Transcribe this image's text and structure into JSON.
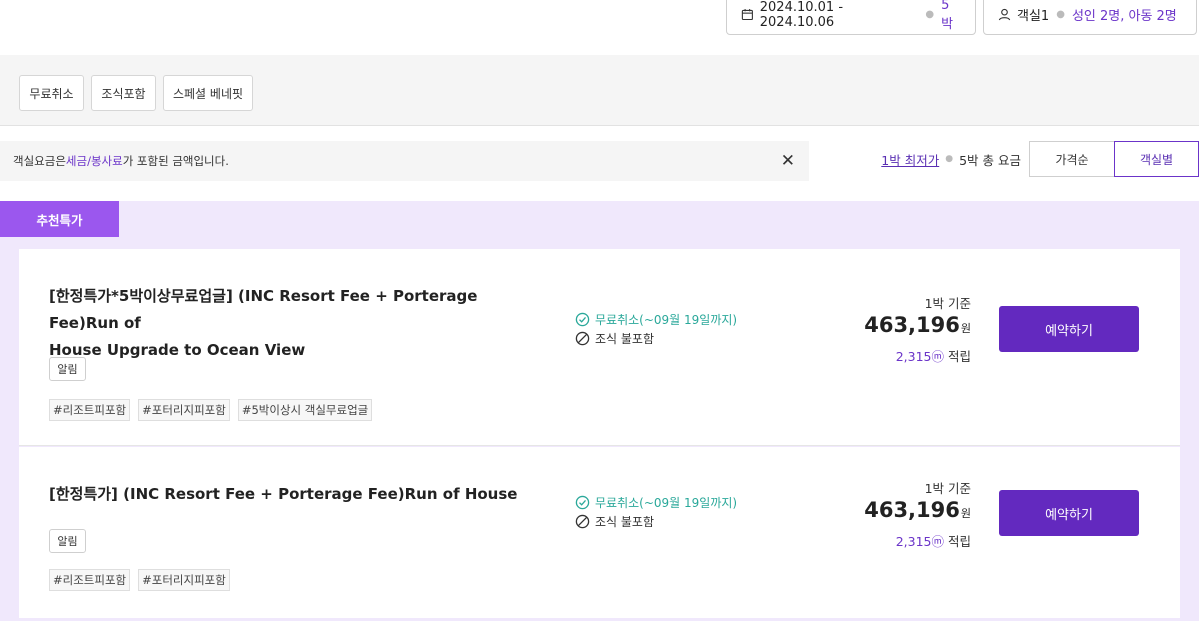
{
  "search": {
    "dates": "2024.10.01 - 2024.10.06",
    "nights": "5박",
    "rooms": "객실1",
    "guests": "성인 2명, 아동 2명"
  },
  "filters": [
    "무료취소",
    "조식포함",
    "스페셜 베네핏"
  ],
  "notice": {
    "prefix": "객실요금은 ",
    "highlight": "세금/봉사료",
    "suffix": "가 포함된 금액입니다."
  },
  "price_toggle": {
    "lowest": "1박 최저가",
    "total": "5박 총 요금"
  },
  "sort": {
    "price": "가격순",
    "room": "객실별"
  },
  "promo_label": "추천특가",
  "rooms": [
    {
      "title_line1": "[한정특가*5박이상무료업글] (INC Resort Fee + Porterage Fee)Run of",
      "title_line2": "House Upgrade to Ocean View",
      "alert": "알림",
      "tags": [
        "#리조트피포함",
        "#포터리지피포함",
        "#5박이상시 객실무료업글"
      ],
      "free_cancel": "무료취소(~09월 19일까지)",
      "breakfast": "조식 불포함",
      "per_label": "1박 기준",
      "price": "463,196",
      "currency": "원",
      "points": "2,315ⓜ",
      "points_label": " 적립",
      "book": "예약하기"
    },
    {
      "title_line1": "[한정특가] (INC Resort Fee + Porterage Fee)Run of House",
      "title_line2": "",
      "alert": "알림",
      "tags": [
        "#리조트피포함",
        "#포터리지피포함"
      ],
      "free_cancel": "무료취소(~09월 19일까지)",
      "breakfast": "조식 불포함",
      "per_label": "1박 기준",
      "price": "463,196",
      "currency": "원",
      "points": "2,315ⓜ",
      "points_label": " 적립",
      "book": "예약하기"
    }
  ],
  "colors": {
    "accent": "#6b34c9",
    "promo": "#9b57ee",
    "book": "#6329bf",
    "free": "#2aa89a"
  }
}
